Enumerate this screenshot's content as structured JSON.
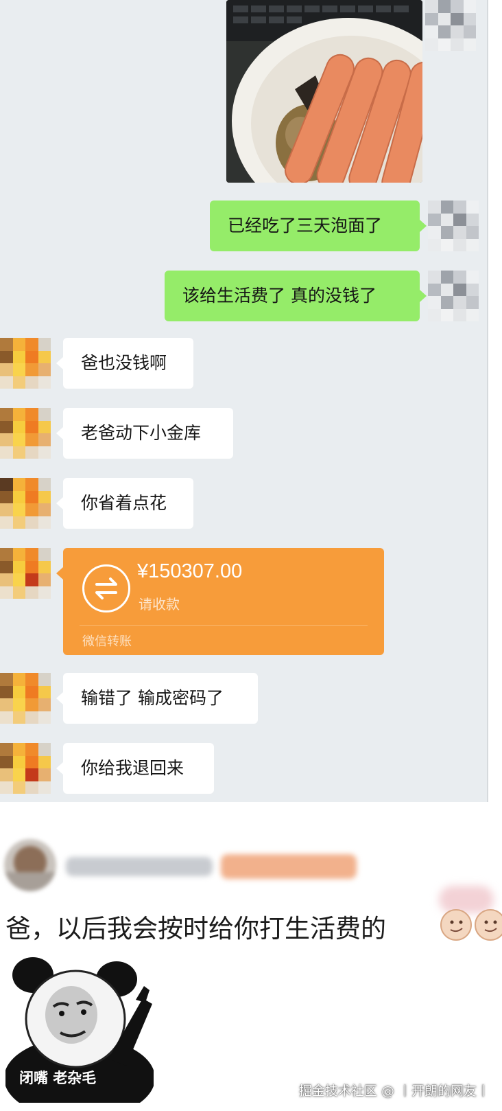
{
  "messages": [
    {
      "side": "right",
      "text": "已经吃了三天泡面了"
    },
    {
      "side": "right",
      "text": "该给生活费了 真的没钱了"
    },
    {
      "side": "left",
      "text": "爸也没钱啊"
    },
    {
      "side": "left",
      "text": "老爸动下小金库"
    },
    {
      "side": "left",
      "text": "你省着点花"
    },
    {
      "side": "left",
      "text": "输错了 输成密码了"
    },
    {
      "side": "left",
      "text": "你给我退回来"
    }
  ],
  "transfer": {
    "amount": "¥150307.00",
    "status": "请收款",
    "service": "微信转账",
    "icon": "exchange-arrows-icon"
  },
  "photo": {
    "icon": "bowl-of-noodles-and-sausages-photo"
  },
  "comment": {
    "text": "爸，以后我会按时给你打生活费的",
    "emoji": "smirk-face-emoji"
  },
  "meme": {
    "caption": "闭嘴 老杂毛",
    "icon": "panda-man-meme"
  },
  "watermark": "掘金技术社区 @ 丨开朗的网友丨",
  "colors": {
    "chat_bg": "#e9edf0",
    "outgoing_bubble": "#95ec69",
    "incoming_bubble": "#ffffff",
    "transfer_card": "#f79c3a"
  }
}
